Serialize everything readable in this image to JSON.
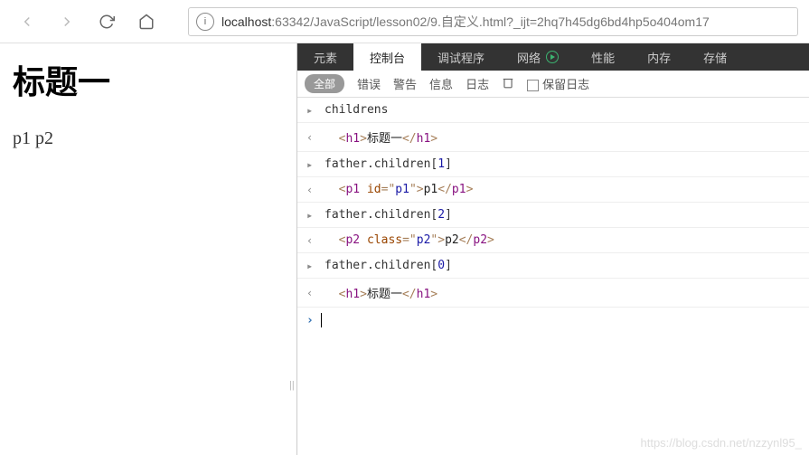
{
  "toolbar": {
    "url_host": "localhost",
    "url_path": ":63342/JavaScript/lesson02/9.自定义.html?_ijt=2hq7h45dg6bd4hp5o404om17"
  },
  "page": {
    "heading": "标题一",
    "paragraph": "p1 p2"
  },
  "devtools": {
    "tabs": [
      "元素",
      "控制台",
      "调试程序",
      "网络",
      "性能",
      "内存",
      "存储"
    ],
    "active_tab": 1,
    "filters": {
      "all": "全部",
      "error": "错误",
      "warn": "警告",
      "info": "信息",
      "log": "日志",
      "preserve": "保留日志"
    },
    "rows": [
      {
        "kind": "out",
        "plain": "childrens"
      },
      {
        "kind": "html",
        "tag": "h1",
        "attrs": "",
        "text": "标题一"
      },
      {
        "kind": "out",
        "expr_pre": "father.children[",
        "expr_num": "1",
        "expr_post": "]"
      },
      {
        "kind": "html",
        "tag": "p1",
        "attrs_name": "id",
        "attrs_val": "p1",
        "text": "p1"
      },
      {
        "kind": "out",
        "expr_pre": "father.children[",
        "expr_num": "2",
        "expr_post": "]"
      },
      {
        "kind": "html",
        "tag": "p2",
        "attrs_name": "class",
        "attrs_val": "p2",
        "text": "p2"
      },
      {
        "kind": "out",
        "expr_pre": "father.children[",
        "expr_num": "0",
        "expr_post": "]"
      },
      {
        "kind": "html",
        "tag": "h1",
        "attrs": "",
        "text": "标题一"
      }
    ]
  },
  "watermark": "https://blog.csdn.net/nzzynl95_"
}
